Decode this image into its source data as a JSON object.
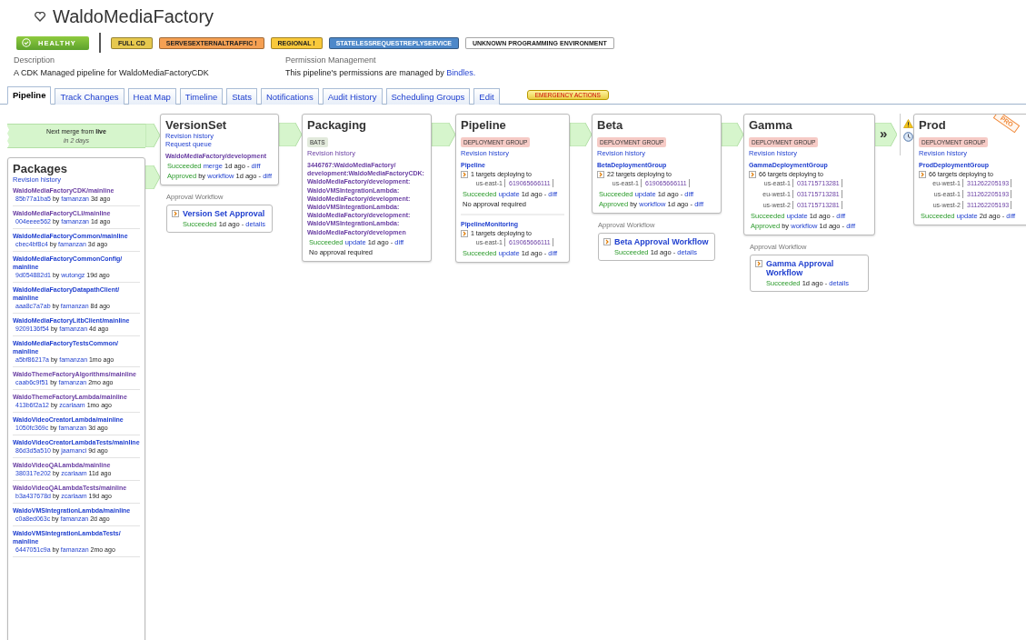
{
  "header": {
    "title": "WaldoMediaFactory",
    "health": "HEALTHY",
    "tags": [
      {
        "label": "FULL CD",
        "color": "#e6c84e"
      },
      {
        "label": "SERVESEXTERNALTRAFFIC !",
        "color": "#f5a053"
      },
      {
        "label": "REGIONAL !",
        "color": "#f9c93a"
      },
      {
        "label": "STATELESSREQUESTREPLYSERVICE",
        "color": "#4d88c9"
      },
      {
        "label": "UNKNOWN PROGRAMMING ENVIRONMENT",
        "color": "#ffffff"
      }
    ],
    "description": {
      "label": "Description",
      "text": "A CDK Managed pipeline for WaldoMediaFactoryCDK"
    },
    "permission": {
      "label": "Permission Management",
      "text": "This pipeline's permissions are managed by",
      "link": "Bindles."
    }
  },
  "tabs": [
    {
      "label": "Pipeline",
      "selected": true
    },
    {
      "label": "Track Changes",
      "selected": false
    },
    {
      "label": "Heat Map",
      "selected": false
    },
    {
      "label": "Timeline",
      "selected": false
    },
    {
      "label": "Stats",
      "selected": false
    },
    {
      "label": "Notifications",
      "selected": false
    },
    {
      "label": "Audit History",
      "selected": false
    },
    {
      "label": "Scheduling Groups",
      "selected": false
    },
    {
      "label": "Edit",
      "selected": false
    }
  ],
  "emergency_button": "EMERGENCY ACTIONS",
  "merge": {
    "text": "Next merge from **live**",
    "when": "in 2 days"
  },
  "packages": {
    "title": "Packages",
    "link": "Revision history",
    "items": [
      {
        "name": "WaldoMediaFactoryCDK/mainline",
        "visited": true,
        "commit": "85b77a1ba5",
        "by": "by",
        "author": "famanzan",
        "age": "3d ago"
      },
      {
        "name": "WaldoMediaFactoryCLI/mainline",
        "visited": true,
        "commit": "004eeee562",
        "by": "by",
        "author": "famanzan",
        "age": "1d ago"
      },
      {
        "name": "WaldoMediaFactoryCommon/mainline",
        "visited": false,
        "commit": "cbec4bf8c4",
        "by": "by",
        "author": "famanzan",
        "age": "3d ago"
      },
      {
        "name": "WaldoMediaFactoryCommonConfig/mainline",
        "visited": false,
        "commit": "9d054882d1",
        "by": "by",
        "author": "wutongz",
        "age": "19d ago"
      },
      {
        "name": "WaldoMediaFactoryDatapathClient/mainline",
        "visited": false,
        "commit": "aaa8c7a7ab",
        "by": "by",
        "author": "famanzan",
        "age": "8d ago"
      },
      {
        "name": "WaldoMediaFactoryLitbClient/mainline",
        "visited": false,
        "commit": "9209136f54",
        "by": "by",
        "author": "famanzan",
        "age": "4d ago"
      },
      {
        "name": "WaldoMediaFactoryTestsCommon/mainline",
        "visited": false,
        "commit": "a5bf86217a",
        "by": "by",
        "author": "famanzan",
        "age": "1mo ago"
      },
      {
        "name": "WaldoThemeFactoryAlgorithms/mainline",
        "visited": true,
        "commit": "caab6c9f51",
        "by": "by",
        "author": "famanzan",
        "age": "2mo ago"
      },
      {
        "name": "WaldoThemeFactoryLambda/mainline",
        "visited": true,
        "commit": "413b6f2a12",
        "by": "by",
        "author": "zcarlaam",
        "age": "1mo ago"
      },
      {
        "name": "WaldoVideoCreatorLambda/mainline",
        "visited": false,
        "commit": "1050fc369c",
        "by": "by",
        "author": "famanzan",
        "age": "3d ago"
      },
      {
        "name": "WaldoVideoCreatorLambdaTests/mainline",
        "visited": false,
        "commit": "86d3d5a510",
        "by": "by",
        "author": "jaamanci",
        "age": "9d ago"
      },
      {
        "name": "WaldoVideoQALambda/mainline",
        "visited": true,
        "commit": "380317e202",
        "by": "by",
        "author": "zcarlaam",
        "age": "11d ago"
      },
      {
        "name": "WaldoVideoQALambdaTests/mainline",
        "visited": true,
        "commit": "b3a437678d",
        "by": "by",
        "author": "zcarlaam",
        "age": "19d ago"
      },
      {
        "name": "WaldoVMSIntegrationLambda/mainline",
        "visited": false,
        "commit": "c0a8ed063c",
        "by": "by",
        "author": "famanzan",
        "age": "2d ago"
      },
      {
        "name": "WaldoVMSIntegrationLambdaTests/mainline",
        "visited": false,
        "commit": "6447051c9a",
        "by": "by",
        "author": "famanzan",
        "age": "2mo ago"
      }
    ]
  },
  "stages": [
    {
      "title": "VersionSet",
      "links": [
        {
          "text": "Revision history",
          "visited": false
        },
        {
          "text": "Request queue",
          "visited": false
        }
      ],
      "groups": [
        {
          "name": "WaldoMediaFactory/development",
          "visited": true,
          "lines": [
            [
              {
                "kind": "status",
                "text": "Succeeded"
              },
              {
                "kind": "link",
                "text": "merge"
              },
              {
                "kind": "plain",
                "text": "1d ago -"
              },
              {
                "kind": "link",
                "text": "diff"
              }
            ],
            [
              {
                "kind": "status",
                "text": "Approved"
              },
              {
                "kind": "plain",
                "text": "by"
              },
              {
                "kind": "link",
                "text": "workflow"
              },
              {
                "kind": "plain",
                "text": "1d ago -"
              },
              {
                "kind": "link",
                "text": "diff"
              }
            ]
          ]
        }
      ],
      "approval": {
        "label": "Approval Workflow",
        "title": "Version Set Approval",
        "status": "Succeeded",
        "age": "1d ago -",
        "link": "details"
      }
    },
    {
      "title": "Packaging",
      "badge": {
        "text": "BATS",
        "color": "#e2eadc"
      },
      "links": [
        {
          "text": "Revision history",
          "visited": true
        }
      ],
      "groups": [
        {
          "name": "3446767:WaldoMediaFactory/development:WaldoMediaFactoryCDK:WaldoMediaFactory/development:WaldoVMSIntegrationLambda:WaldoMediaFactory/development:WaldoVMSIntegrationLambda:WaldoMediaFactory/development:WaldoVMSIntegrationLambda:WaldoMediaFactory/developmen",
          "visited": true,
          "lines": [
            [
              {
                "kind": "status",
                "text": "Succeeded"
              },
              {
                "kind": "link",
                "text": "update"
              },
              {
                "kind": "plain",
                "text": "1d ago -"
              },
              {
                "kind": "link",
                "text": "diff"
              }
            ],
            [
              {
                "kind": "plain",
                "text": "No approval required"
              }
            ]
          ]
        }
      ]
    },
    {
      "title": "Pipeline",
      "badge": {
        "text": "DEPLOYMENT GROUP",
        "color": "#f6cbc6"
      },
      "links": [
        {
          "text": "Revision history",
          "visited": false
        }
      ],
      "groups": [
        {
          "name": "Pipeline",
          "visited": false,
          "targets": {
            "text": "1 targets deploying to",
            "rows": [
              {
                "region": "us-east-1",
                "account": "619065666111"
              }
            ]
          },
          "lines": [
            [
              {
                "kind": "status",
                "text": "Succeeded"
              },
              {
                "kind": "link",
                "text": "update"
              },
              {
                "kind": "plain",
                "text": "1d ago -"
              },
              {
                "kind": "link",
                "text": "diff"
              }
            ],
            [
              {
                "kind": "plain",
                "text": "No approval required"
              }
            ]
          ]
        },
        {
          "name": "PipelineMonitoring",
          "visited": false,
          "targets": {
            "text": "1 targets deploying to",
            "rows": [
              {
                "region": "us-east-1",
                "account": "619065666111"
              }
            ]
          },
          "lines": [
            [
              {
                "kind": "status",
                "text": "Succeeded"
              },
              {
                "kind": "link",
                "text": "update"
              },
              {
                "kind": "plain",
                "text": "1d ago -"
              },
              {
                "kind": "link",
                "text": "diff"
              }
            ]
          ]
        }
      ]
    },
    {
      "title": "Beta",
      "badge": {
        "text": "DEPLOYMENT GROUP",
        "color": "#f6cbc6"
      },
      "links": [
        {
          "text": "Revision history",
          "visited": false
        }
      ],
      "groups": [
        {
          "name": "BetaDeploymentGroup",
          "visited": false,
          "targets": {
            "text": "22 targets deploying to",
            "rows": [
              {
                "region": "us-east-1",
                "account": "619065666111"
              }
            ]
          },
          "lines": [
            [
              {
                "kind": "status",
                "text": "Succeeded"
              },
              {
                "kind": "link",
                "text": "update"
              },
              {
                "kind": "plain",
                "text": "1d ago -"
              },
              {
                "kind": "link",
                "text": "diff"
              }
            ],
            [
              {
                "kind": "status",
                "text": "Approved"
              },
              {
                "kind": "plain",
                "text": "by"
              },
              {
                "kind": "link",
                "text": "workflow"
              },
              {
                "kind": "plain",
                "text": "1d ago -"
              },
              {
                "kind": "link",
                "text": "diff"
              }
            ]
          ]
        }
      ],
      "approval": {
        "label": "Approval Workflow",
        "title": "Beta Approval Workflow",
        "status": "Succeeded",
        "age": "1d ago -",
        "link": "details"
      }
    },
    {
      "title": "Gamma",
      "badge": {
        "text": "DEPLOYMENT GROUP",
        "color": "#f6cbc6"
      },
      "links": [
        {
          "text": "Revision history",
          "visited": false
        }
      ],
      "groups": [
        {
          "name": "GammaDeploymentGroup",
          "visited": false,
          "targets": {
            "text": "66 targets deploying to",
            "rows": [
              {
                "region": "us-east-1",
                "account": "031715713281"
              },
              {
                "region": "eu-west-1",
                "account": "031715713281"
              },
              {
                "region": "us-west-2",
                "account": "031715713281"
              }
            ]
          },
          "lines": [
            [
              {
                "kind": "status",
                "text": "Succeeded"
              },
              {
                "kind": "link",
                "text": "update"
              },
              {
                "kind": "plain",
                "text": "1d ago -"
              },
              {
                "kind": "link",
                "text": "diff"
              }
            ],
            [
              {
                "kind": "status",
                "text": "Approved"
              },
              {
                "kind": "plain",
                "text": "by"
              },
              {
                "kind": "link",
                "text": "workflow"
              },
              {
                "kind": "plain",
                "text": "1d ago -"
              },
              {
                "kind": "link",
                "text": "diff"
              }
            ]
          ]
        }
      ],
      "approval": {
        "label": "Approval Workflow",
        "title": "Gamma Approval Workflow",
        "status": "Succeeded",
        "age": "1d ago -",
        "link": "details"
      }
    },
    {
      "title": "Prod",
      "gate": {
        "glyph": "»"
      },
      "ribbon": "PRO",
      "badge": {
        "text": "DEPLOYMENT GROUP",
        "color": "#f6cbc6"
      },
      "links": [
        {
          "text": "Revision history",
          "visited": false
        }
      ],
      "groups": [
        {
          "name": "ProdDeploymentGroup",
          "visited": false,
          "targets": {
            "text": "66 targets deploying to",
            "rows": [
              {
                "region": "eu-west-1",
                "account": "311262205193"
              },
              {
                "region": "us-east-1",
                "account": "311262205193"
              },
              {
                "region": "us-west-2",
                "account": "311262205193"
              }
            ]
          },
          "lines": [
            [
              {
                "kind": "status",
                "text": "Succeeded"
              },
              {
                "kind": "link",
                "text": "update"
              },
              {
                "kind": "plain",
                "text": "2d ago -"
              },
              {
                "kind": "link",
                "text": "diff"
              }
            ]
          ]
        }
      ]
    }
  ]
}
